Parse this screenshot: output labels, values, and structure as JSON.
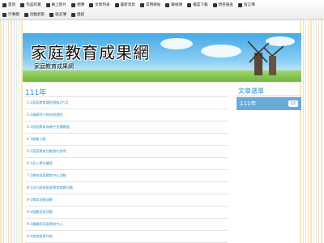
{
  "nav": {
    "row1": [
      {
        "label": "首頁",
        "icon": "home-icon"
      },
      {
        "label": "作品欣賞",
        "icon": "image-icon"
      },
      {
        "label": "線上影片",
        "icon": "video-icon"
      },
      {
        "label": "相簿",
        "icon": "photo-icon"
      },
      {
        "label": "文章列表",
        "icon": "list-icon"
      },
      {
        "label": "最新消息",
        "icon": "news-icon"
      },
      {
        "label": "常用網站",
        "icon": "globe-icon"
      },
      {
        "label": "聯絡簿",
        "icon": "contact-icon"
      },
      {
        "label": "檔案下載",
        "icon": "download-icon"
      },
      {
        "label": "問卷調查",
        "icon": "question-icon"
      },
      {
        "label": "留言簿",
        "icon": "comment-icon"
      }
    ],
    "row2": [
      {
        "label": "行事曆",
        "icon": "calendar-icon"
      },
      {
        "label": "活動剪影",
        "icon": "camera-icon"
      },
      {
        "label": "收支簿",
        "icon": "money-icon"
      },
      {
        "label": "連結",
        "icon": "link-icon"
      }
    ]
  },
  "banner": {
    "title": "家庭教育成果網",
    "subtitle": "家庭教育成果網"
  },
  "main": {
    "title": "111年",
    "posts": [
      "1-1家庭教育課程實施2六月",
      "2-1親師四十時研習證明",
      "3-1研習教育與親子共讀實施",
      "4-1推動小組",
      "5-1家庭教育活動照片說明",
      "6-1家人學生輔導",
      "7-1學校家庭教育中心活動",
      "8-1自行辦理家庭教育相關活動",
      "9-1教育活動成果",
      "9-2相關宣導活動",
      "9-3親職與家庭教育中心",
      "9-4其他創意作為"
    ]
  },
  "sidebar": {
    "title": "文章選單",
    "item_label": "111年",
    "item_count": "12"
  }
}
